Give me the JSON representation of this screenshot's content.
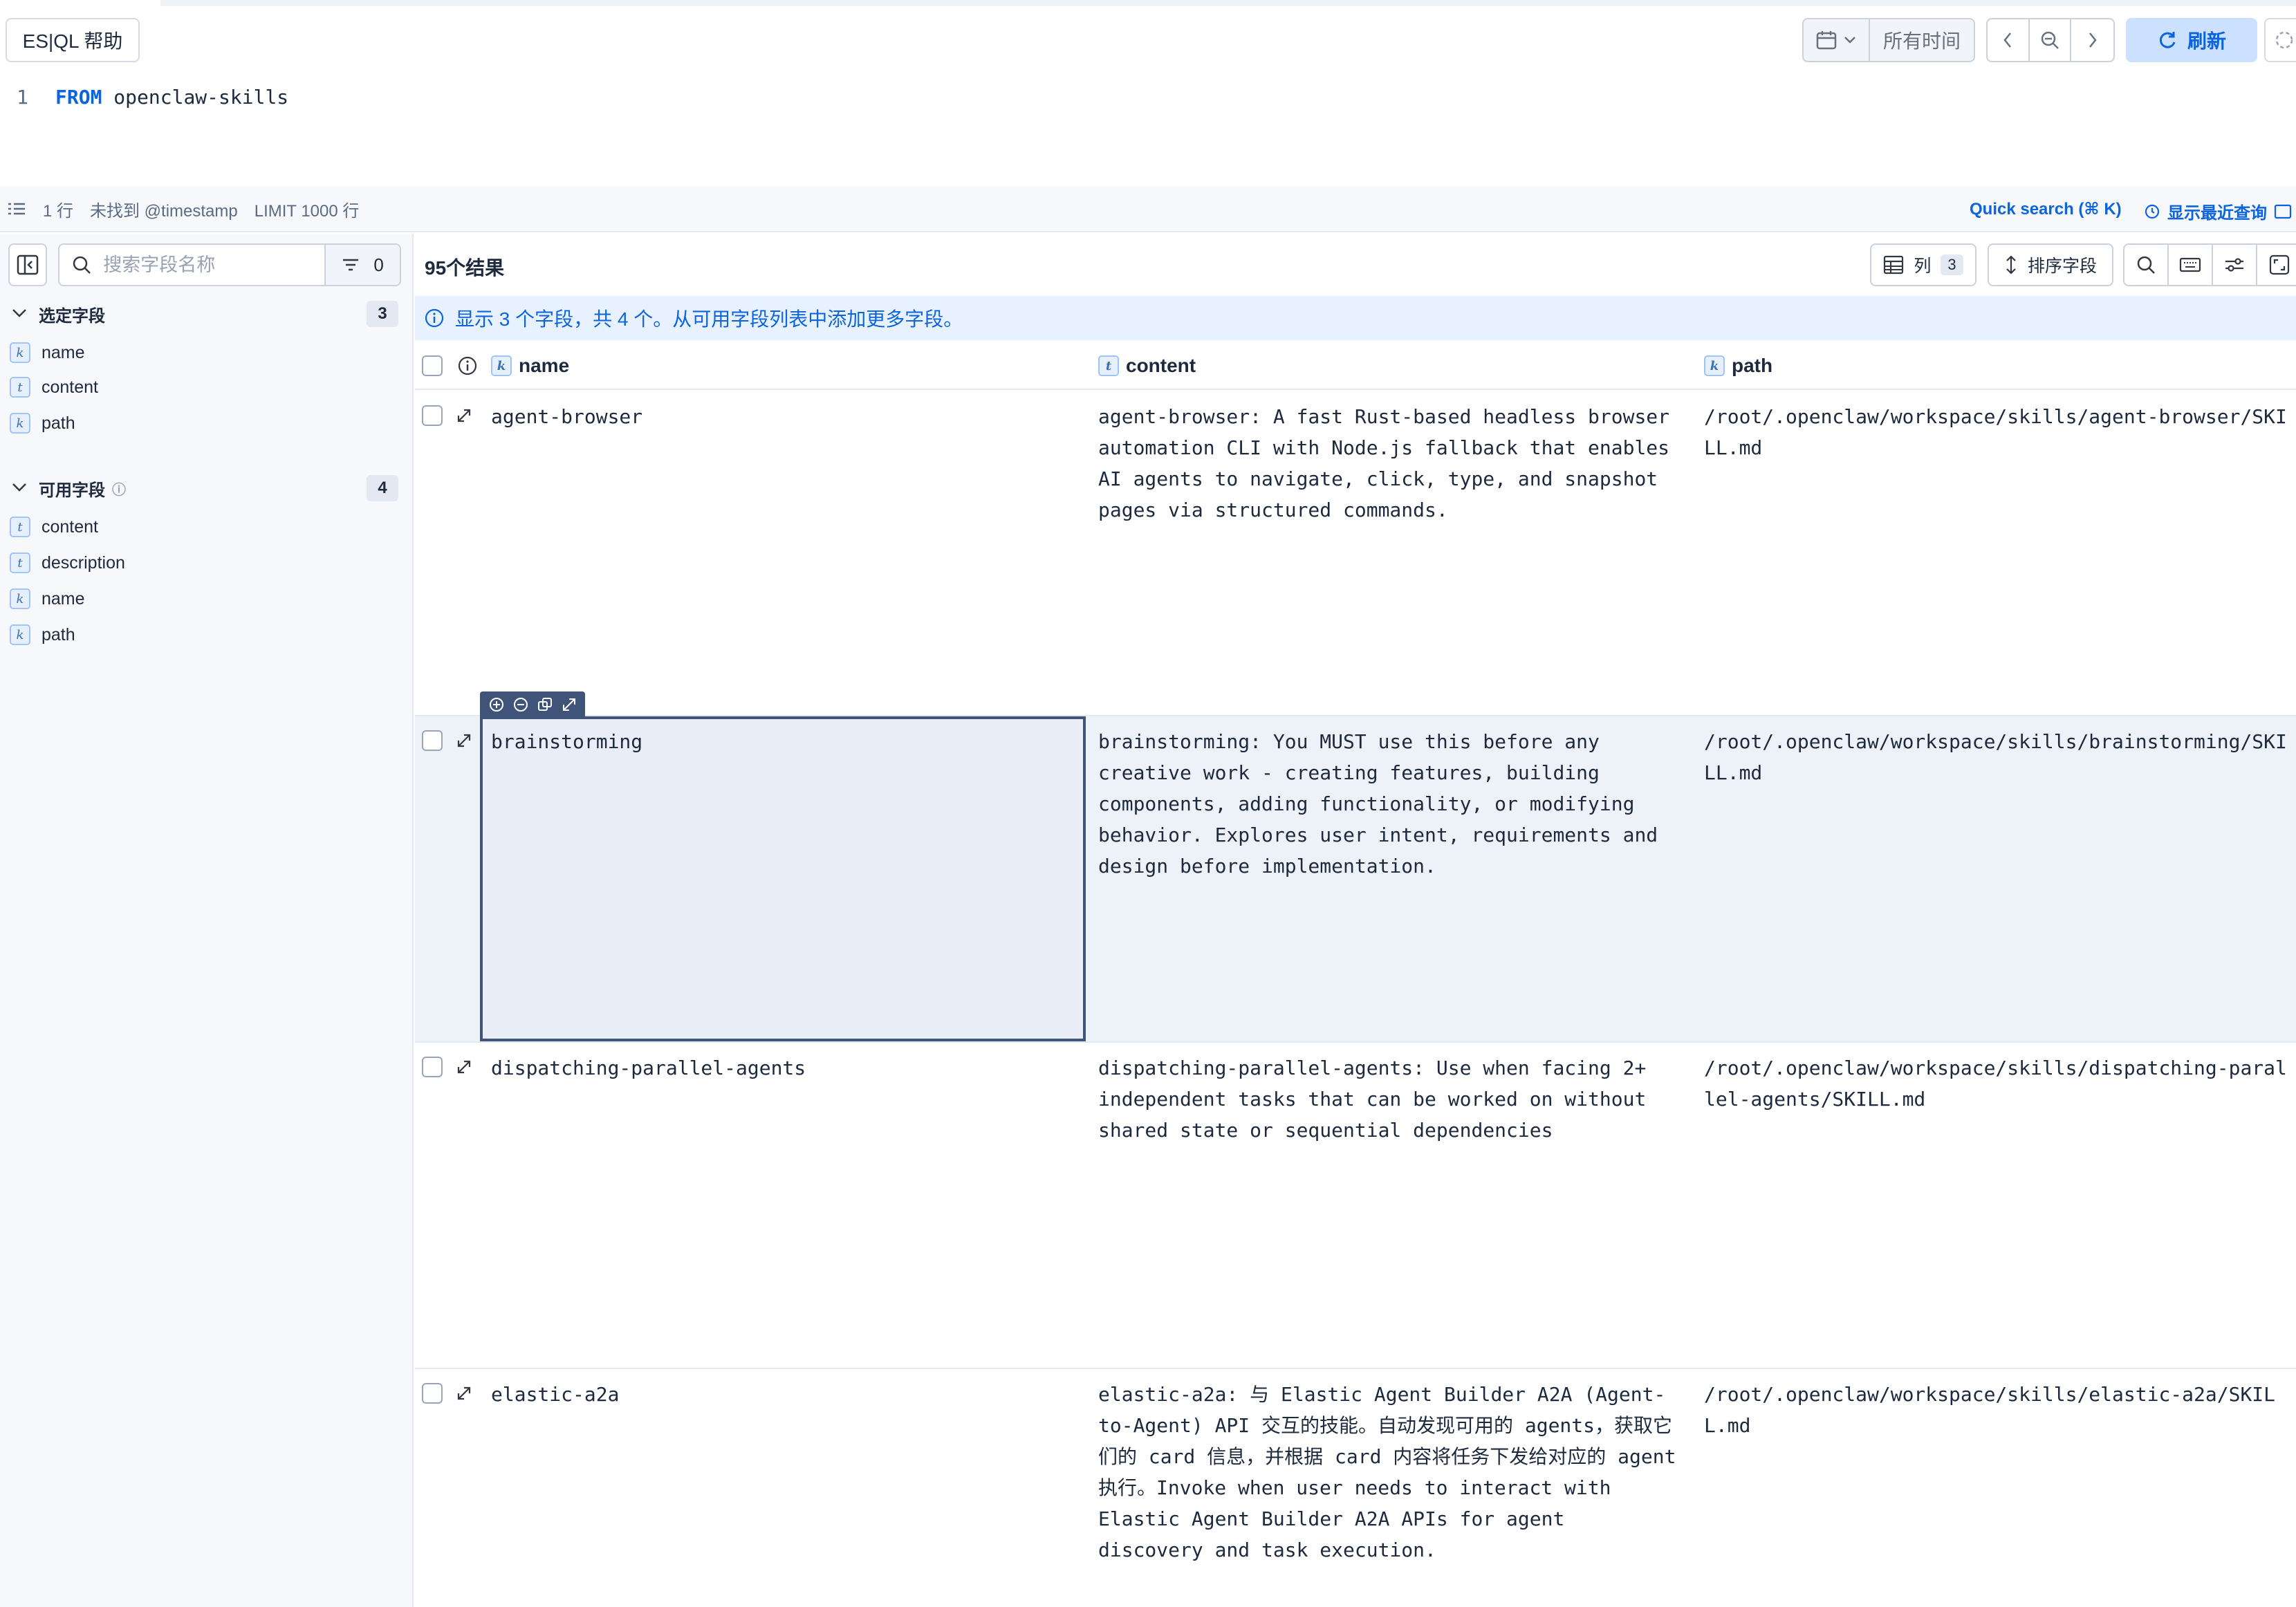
{
  "header": {
    "esql_help": "ES|QL 帮助",
    "time_label": "所有时间",
    "refresh": "刷新"
  },
  "editor": {
    "line_number": "1",
    "keyword": "FROM",
    "index": "openclaw-skills"
  },
  "status": {
    "rows": "1 行",
    "no_timestamp": "未找到 @timestamp",
    "limit": "LIMIT 1000 行",
    "quick_search": "Quick search (⌘ K)",
    "recent_queries": "显示最近查询"
  },
  "sidebar": {
    "search_placeholder": "搜索字段名称",
    "filter_count": "0",
    "selected": {
      "title": "选定字段",
      "count": "3",
      "items": [
        {
          "type": "k",
          "name": "name"
        },
        {
          "type": "t",
          "name": "content"
        },
        {
          "type": "k",
          "name": "path"
        }
      ]
    },
    "available": {
      "title": "可用字段",
      "count": "4",
      "items": [
        {
          "type": "t",
          "name": "content"
        },
        {
          "type": "t",
          "name": "description"
        },
        {
          "type": "k",
          "name": "name"
        },
        {
          "type": "k",
          "name": "path"
        }
      ]
    }
  },
  "grid": {
    "results": "95个结果",
    "columns_label": "列",
    "columns_count": "3",
    "sort_label": "排序字段",
    "callout": "显示 3 个字段，共 4 个。从可用字段列表中添加更多字段。",
    "headers": [
      {
        "type": "k",
        "label": "name"
      },
      {
        "type": "t",
        "label": "content"
      },
      {
        "type": "k",
        "label": "path"
      }
    ],
    "rows": [
      {
        "name": "agent-browser",
        "content": "agent-browser: A fast Rust-based headless browser automation CLI with Node.js fallback that enables AI agents to navigate, click, type, and snapshot pages via structured commands.",
        "path": "/root/.openclaw/workspace/skills/agent-browser/SKILL.md"
      },
      {
        "name": "brainstorming",
        "content": "brainstorming: You MUST use this before any creative work - creating features, building components, adding functionality, or modifying behavior. Explores user intent, requirements and design before implementation.",
        "path": "/root/.openclaw/workspace/skills/brainstorming/SKILL.md"
      },
      {
        "name": "dispatching-parallel-agents",
        "content": "dispatching-parallel-agents: Use when facing 2+ independent tasks that can be worked on without shared state or sequential dependencies",
        "path": "/root/.openclaw/workspace/skills/dispatching-parallel-agents/SKILL.md"
      },
      {
        "name": "elastic-a2a",
        "content": "elastic-a2a: 与 Elastic Agent Builder A2A (Agent-to-Agent) API 交互的技能。自动发现可用的 agents，获取它们的 card 信息，并根据 card 内容将任务下发给对应的 agent 执行。Invoke when user needs to interact with Elastic Agent Builder A2A APIs for agent discovery and task execution.",
        "path": "/root/.openclaw/workspace/skills/elastic-a2a/SKILL.md"
      }
    ]
  }
}
